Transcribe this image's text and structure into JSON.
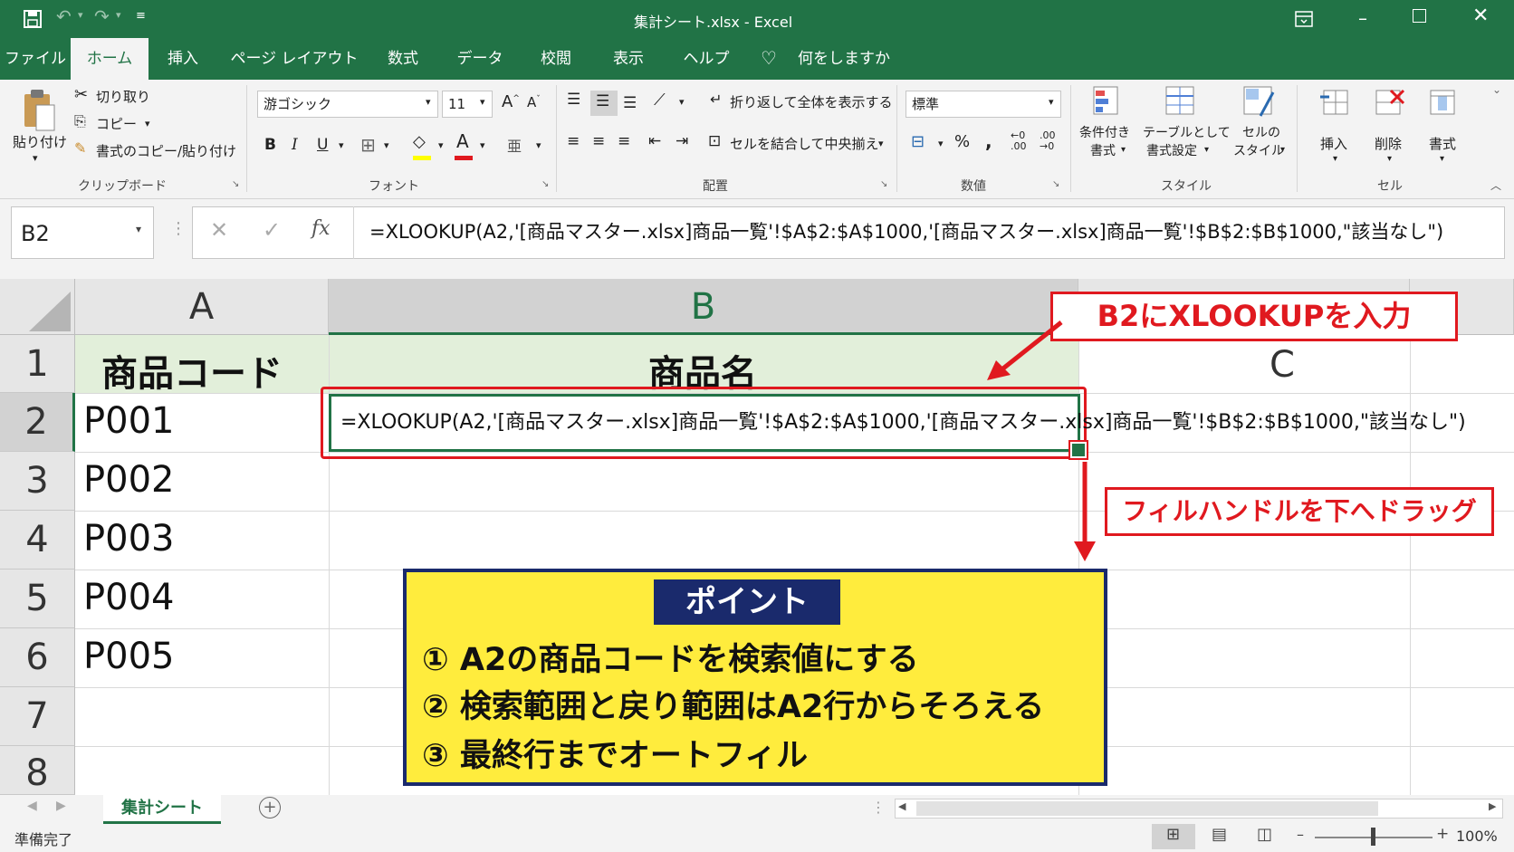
{
  "window": {
    "title": "集計シート.xlsx  -  Excel"
  },
  "tabs": [
    "ファイル",
    "ホーム",
    "挿入",
    "ページ レイアウト",
    "数式",
    "データ",
    "校閲",
    "表示",
    "ヘルプ"
  ],
  "tell_me": "何をしますか",
  "ribbon": {
    "paste": "貼り付け",
    "cut": "切り取り",
    "copy": "コピー",
    "format_painter": "書式のコピー/貼り付け",
    "clipboard": "クリップボード",
    "font_name": "游ゴシック",
    "font_size": "11",
    "bold": "B",
    "italic": "I",
    "underline": "U",
    "font_group": "フォント",
    "wrap_text": "折り返して全体を表示する",
    "merge_center": "セルを結合して中央揃え",
    "alignment": "配置",
    "number_format": "標準",
    "percent": "%",
    "comma": ",",
    "number": "数値",
    "conditional_format_1": "条件付き",
    "conditional_format_2": "書式",
    "format_as_table_1": "テーブルとして",
    "format_as_table_2": "書式設定",
    "cell_styles_1": "セルの",
    "cell_styles_2": "スタイル",
    "styles": "スタイル",
    "insert": "挿入",
    "delete": "削除",
    "format": "書式",
    "cells": "セル"
  },
  "formula_bar": {
    "name_box": "B2",
    "fx": "fx",
    "formula": "=XLOOKUP(A2,'[商品マスター.xlsx]商品一覧'!$A$2:$A$1000,'[商品マスター.xlsx]商品一覧'!$B$2:$B$1000,\"該当なし\")"
  },
  "grid": {
    "columns": [
      "A",
      "B",
      "C"
    ],
    "rows": [
      "1",
      "2",
      "3",
      "4",
      "5",
      "6",
      "7",
      "8"
    ],
    "header_a": "商品コード",
    "header_b": "商品名",
    "codes": [
      "P001",
      "P002",
      "P003",
      "P004",
      "P005"
    ],
    "b2_formula": "=XLOOKUP(A2,'[商品マスター.xlsx]商品一覧'!$A$2:$A$1000,'[商品マスター.xlsx]商品一覧'!$B$2:$B$1000,\"該当なし\")"
  },
  "callouts": {
    "input": "B2にXLOOKUPを入力",
    "fill": "フィルハンドルを下へドラッグ"
  },
  "point": {
    "title": "ポイント",
    "items": [
      "① A2の商品コードを検索値にする",
      "② 検索範囲と戻り範囲はA2行からそろえる",
      "③ 最終行までオートフィル"
    ]
  },
  "sheet_tab": "集計シート",
  "status": {
    "ready": "準備完了",
    "zoom": "100%"
  },
  "colors": {
    "excel_green": "#217346",
    "callout_red": "#e0191f",
    "point_yellow": "#ffec3d",
    "point_navy": "#1a2a6c"
  }
}
